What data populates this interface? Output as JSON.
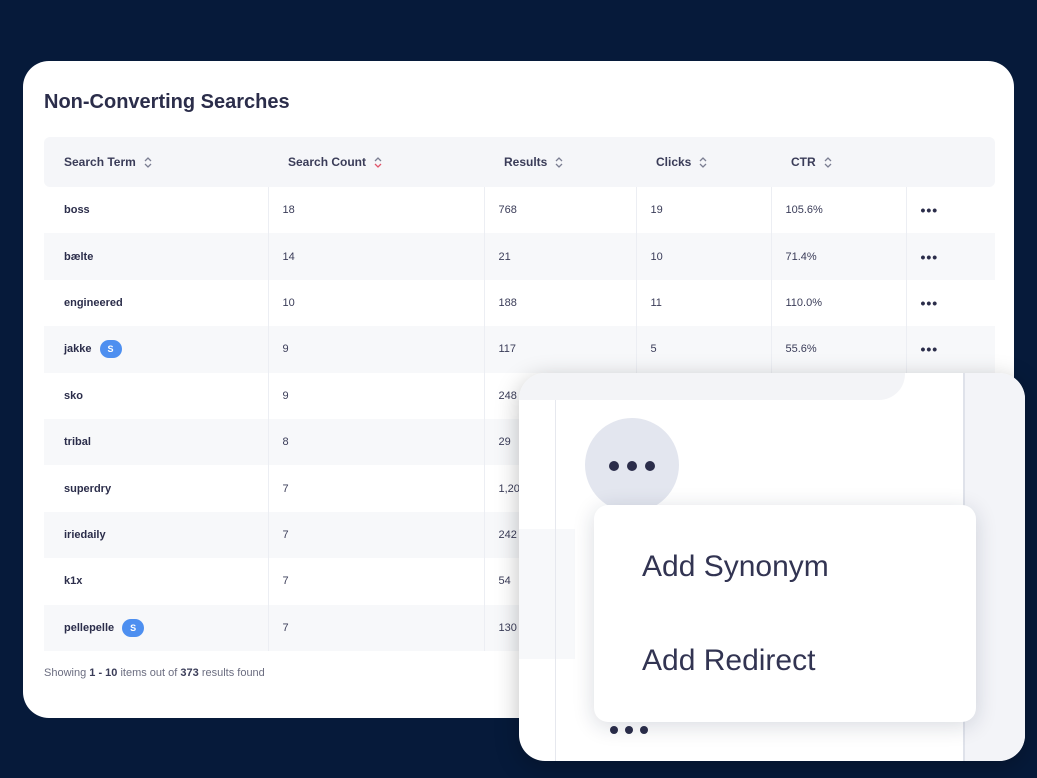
{
  "panel": {
    "title": "Non-Converting Searches"
  },
  "table": {
    "columns": [
      "Search Term",
      "Search Count",
      "Results",
      "Clicks",
      "CTR"
    ],
    "rows": [
      {
        "term": "boss",
        "count": "18",
        "results": "768",
        "clicks": "19",
        "ctr": "105.6%",
        "badge": ""
      },
      {
        "term": "bælte",
        "count": "14",
        "results": "21",
        "clicks": "10",
        "ctr": "71.4%",
        "badge": ""
      },
      {
        "term": "engineered",
        "count": "10",
        "results": "188",
        "clicks": "11",
        "ctr": "110.0%",
        "badge": ""
      },
      {
        "term": "jakke",
        "count": "9",
        "results": "117",
        "clicks": "5",
        "ctr": "55.6%",
        "badge": "S"
      },
      {
        "term": "sko",
        "count": "9",
        "results": "248",
        "clicks": "",
        "ctr": "",
        "badge": ""
      },
      {
        "term": "tribal",
        "count": "8",
        "results": "29",
        "clicks": "",
        "ctr": "",
        "badge": ""
      },
      {
        "term": "superdry",
        "count": "7",
        "results": "1,20",
        "clicks": "",
        "ctr": "",
        "badge": ""
      },
      {
        "term": "iriedaily",
        "count": "7",
        "results": "242",
        "clicks": "",
        "ctr": "",
        "badge": ""
      },
      {
        "term": "k1x",
        "count": "7",
        "results": "54",
        "clicks": "",
        "ctr": "",
        "badge": ""
      },
      {
        "term": "pellepelle",
        "count": "7",
        "results": "130",
        "clicks": "",
        "ctr": "",
        "badge": "S"
      }
    ],
    "row_menu": "•••"
  },
  "footer": {
    "prefix": "Showing",
    "range": "1 - 10",
    "middle": "items out of",
    "total": "373",
    "suffix": "results found"
  },
  "menu": {
    "add_synonym": "Add Synonym",
    "add_redirect": "Add Redirect"
  },
  "colors": {
    "background": "#061a3a",
    "badge": "#4d8ff0",
    "active_sort": "#e0556a"
  }
}
